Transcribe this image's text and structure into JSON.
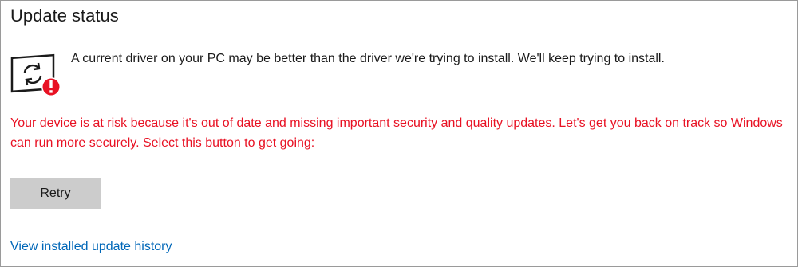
{
  "section": {
    "title": "Update status"
  },
  "status": {
    "icon": "sync-warning-icon",
    "message": "A current driver on your PC may be better than the driver we're trying to install. We'll keep trying to install."
  },
  "warning": {
    "text": "Your device is at risk because it's out of date and missing important security and quality updates. Let's get you back on track so Windows can run more securely. Select this button to get going:",
    "color": "#e81123"
  },
  "actions": {
    "retry_label": "Retry",
    "history_link": "View installed update history"
  },
  "colors": {
    "link": "#0067b8",
    "button_bg": "#cccccc",
    "alert_badge": "#e81123"
  }
}
